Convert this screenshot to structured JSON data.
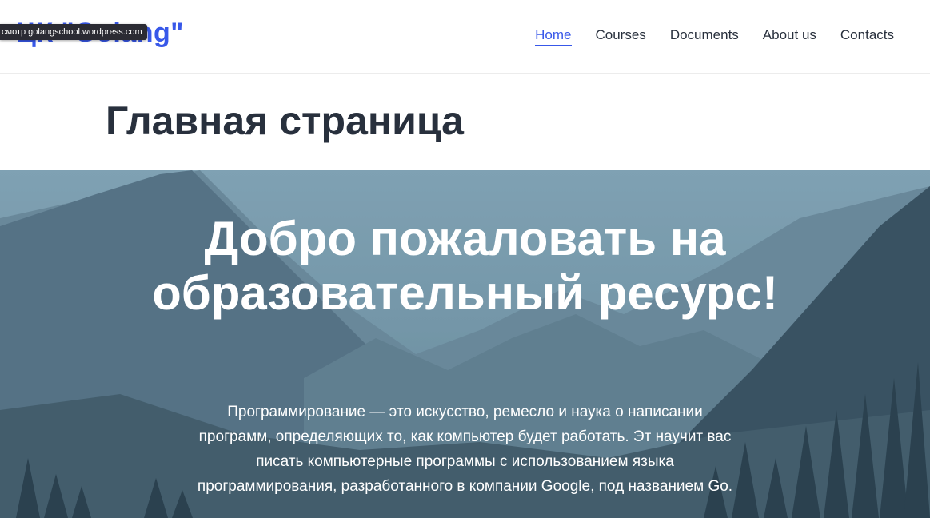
{
  "header": {
    "site_title": "ЦК \"Golang\"",
    "preview_badge": "смотр golangschool.wordpress.com",
    "nav": [
      {
        "label": "Home",
        "active": true
      },
      {
        "label": "Courses",
        "active": false
      },
      {
        "label": "Documents",
        "active": false
      },
      {
        "label": "About us",
        "active": false
      },
      {
        "label": "Contacts",
        "active": false
      }
    ]
  },
  "page": {
    "title": "Главная страница"
  },
  "hero": {
    "heading": "Добро пожаловать на образовательный ресурс!",
    "text": "Программирование — это искусство, ремесло и наука о написании программ, определяющих то, как компьютер будет работать. Эт научит вас писать компьютерные программы с использованием языка программирования, разработанного в компании Google, под названием Go."
  },
  "colors": {
    "accent": "#3858e9",
    "text": "#28303d",
    "hero_sky": "#8fb2c4"
  }
}
